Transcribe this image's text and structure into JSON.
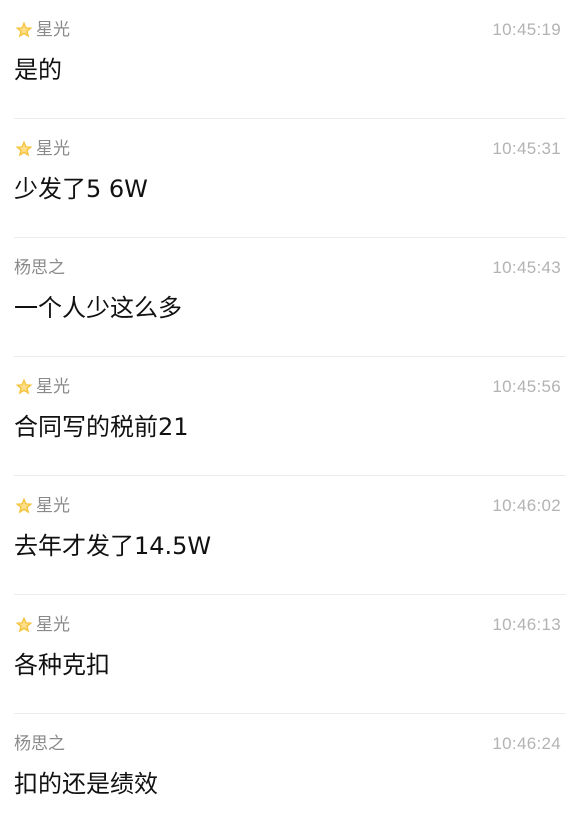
{
  "messages": [
    {
      "sender": "星光",
      "has_star_icon": true,
      "time": "10:45:19",
      "text": "是的"
    },
    {
      "sender": "星光",
      "has_star_icon": true,
      "time": "10:45:31",
      "text": "少发了5 6W"
    },
    {
      "sender": "杨思之",
      "has_star_icon": false,
      "time": "10:45:43",
      "text": "一个人少这么多"
    },
    {
      "sender": "星光",
      "has_star_icon": true,
      "time": "10:45:56",
      "text": "合同写的税前21"
    },
    {
      "sender": "星光",
      "has_star_icon": true,
      "time": "10:46:02",
      "text": "去年才发了14.5W"
    },
    {
      "sender": "星光",
      "has_star_icon": true,
      "time": "10:46:13",
      "text": "各种克扣"
    },
    {
      "sender": "杨思之",
      "has_star_icon": false,
      "time": "10:46:24",
      "text": "扣的还是绩效"
    }
  ],
  "colors": {
    "star_icon": "#f5c542",
    "sender_name": "#8a8a8a",
    "time": "#b3b3b3",
    "text": "#111111",
    "divider": "#ececec"
  }
}
